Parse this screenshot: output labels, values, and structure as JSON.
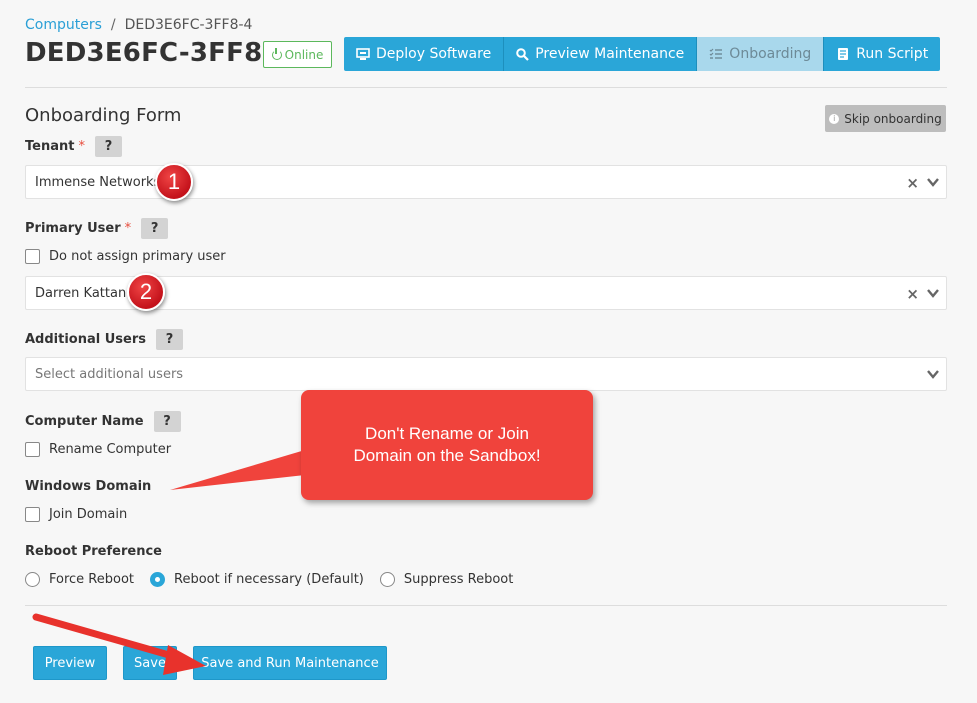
{
  "breadcrumb": {
    "parent": "Computers",
    "separator": "/",
    "current": "DED3E6FC-3FF8-4"
  },
  "page_title": "DED3E6FC-3FF8-4",
  "status": {
    "label": "Online",
    "color": "#5cb85c",
    "icon": "power-icon"
  },
  "toolbar": [
    {
      "label": "Deploy Software",
      "icon": "deploy-icon",
      "active": false
    },
    {
      "label": "Preview Maintenance",
      "icon": "search-icon",
      "active": false
    },
    {
      "label": "Onboarding",
      "icon": "checklist-icon",
      "active": true
    },
    {
      "label": "Run Script",
      "icon": "script-icon",
      "active": false
    }
  ],
  "form": {
    "title": "Onboarding Form",
    "skip_label": "Skip onboarding",
    "help_label": "?",
    "required_marker": "*",
    "tenant": {
      "label": "Tenant",
      "value": "Immense Networks"
    },
    "primary_user": {
      "label": "Primary User",
      "no_assign_label": "Do not assign primary user",
      "value": "Darren Kattan"
    },
    "additional_users": {
      "label": "Additional Users",
      "placeholder": "Select additional users"
    },
    "computer_name": {
      "label": "Computer Name",
      "rename_label": "Rename Computer"
    },
    "windows_domain": {
      "label": "Windows Domain",
      "join_label": "Join Domain"
    },
    "reboot": {
      "label": "Reboot Preference",
      "options": [
        "Force Reboot",
        "Reboot if necessary (Default)",
        "Suppress Reboot"
      ],
      "selected": "Reboot if necessary (Default)"
    }
  },
  "actions": {
    "preview": "Preview",
    "save": "Save",
    "save_run": "Save and Run Maintenance"
  },
  "annotations": {
    "badge_1": "1",
    "badge_2": "2",
    "callout_line1": "Don't Rename or Join",
    "callout_line2": "Domain on the Sandbox!",
    "accent_color": "#f0433c"
  },
  "colors": {
    "primary": "#2aa6d8",
    "active_tab": "#a9d8ec",
    "background": "#f7f7f7"
  }
}
